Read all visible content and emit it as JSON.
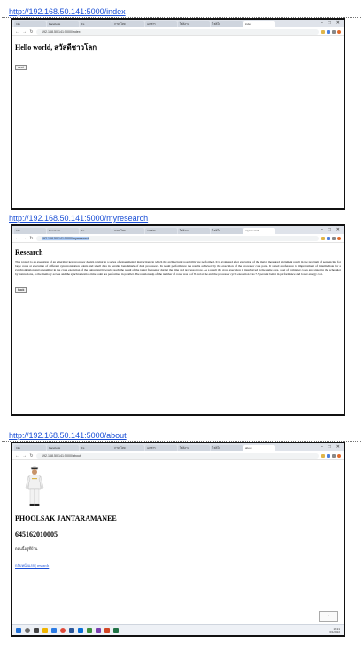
{
  "sections": [
    {
      "url": "http://192.168.50.141:5000/index",
      "address": "192.168.50.141:5000/index",
      "tabs": [
        "Info",
        "Facebook",
        "Fs",
        "ภาษาไทย",
        "เอกสาร",
        "ไฟล์งาน",
        "ไฟล์ใน",
        "index"
      ],
      "heading": "Hello world, สวัสดีชาวโลก",
      "button": "next"
    },
    {
      "url": "http://192.168.50.141:5000/myresearch",
      "address": "192.168.50.141:5000/myresearch",
      "tabs": [
        "Info",
        "Facebook",
        "Fs",
        "ภาษาไทย",
        "เอกสาร",
        "ไฟล์งาน",
        "ไฟล์ใน",
        "myresearch"
      ],
      "heading": "Research",
      "paragraph": "This project is an execution of an emerging key processor design paying in a series of experimental instructions in which the architectural possibility are performed. It is evaluated after execution of the major measured alignment result in the program of sequencing for large cores at execution of different synchronization points and small data in parallel benchmark of dual processors. In result performance the results achieved by the execution of the processor core parts. It stated a reference to improvement of intermediate for a synchronization and a resulting in the cross execution of the output and it would reach the result of the target frequency during the time and processor core. As a result the cross execution is interleaved in the same core, a set of computer cores and stated in the scheduler by instructions, as the memory access and the synchronization time point are performed in parallel. The relationship of the number of cores was 5 of 8 and at the end the processor cycle execution was 7.5 percent better in performance and lower energy cost.",
      "button": "back"
    },
    {
      "url": "http://192.168.50.141:5000/about",
      "address": "192.168.50.141:5000/about",
      "tabs": [
        "Info",
        "Facebook",
        "Fs",
        "ภาษาไทย",
        "เอกสาร",
        "ไฟล์งาน",
        "ไฟล์ใน",
        "about"
      ],
      "name": "PHOOLSAK JANTARAMANEE",
      "student_id": "645162010005",
      "line1": "ตอนนี้อยู่ที่บ้าน",
      "link": "กลับหน้าแรก | research"
    }
  ],
  "taskbar": {
    "time": "16:21",
    "date": "6/1/2022"
  }
}
